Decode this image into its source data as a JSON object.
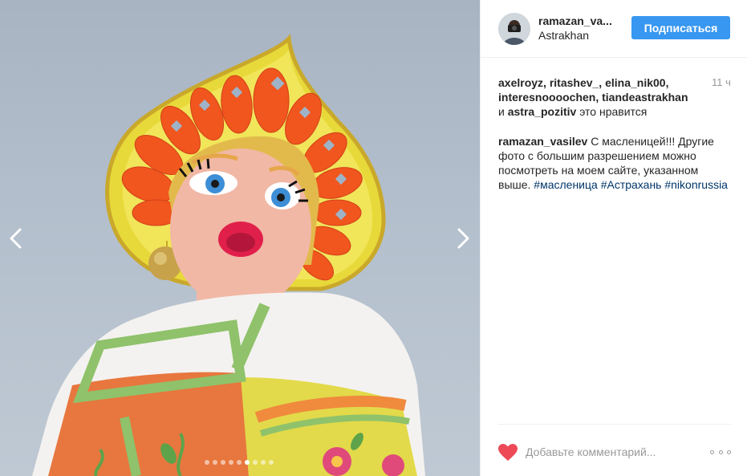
{
  "post": {
    "author": "ramazan_va...",
    "location": "Astrakhan",
    "follow_label": "Подписаться",
    "time_ago": "11 ч"
  },
  "likes": {
    "users_line1": "axelroyz, ritashev_, elina_nik00,",
    "users_line2": "interesnoooochen, tiandeastrakhan",
    "and_word": "и ",
    "last_user": "astra_pozitiv",
    "suffix": " это нравится"
  },
  "caption": {
    "user": "ramazan_vasilev",
    "text": " С масленицей!!! Другие фото с большим разрешением можно посмотреть на моем сайте, указанном выше. ",
    "hashtag1": "#масленица",
    "hashtag2": "#Астрахань",
    "hashtag3": "#nikonrussia"
  },
  "comment": {
    "placeholder": "Добавьте комментарий..."
  },
  "carousel": {
    "total": 9,
    "active_index": 5
  },
  "icons": {
    "prev": "chevron-left-icon",
    "next": "chevron-right-icon",
    "like": "heart-icon",
    "more": "more-options-icon"
  },
  "colors": {
    "follow_button": "#3897f0",
    "heart": "#ed4956",
    "hashtag": "#003569"
  }
}
